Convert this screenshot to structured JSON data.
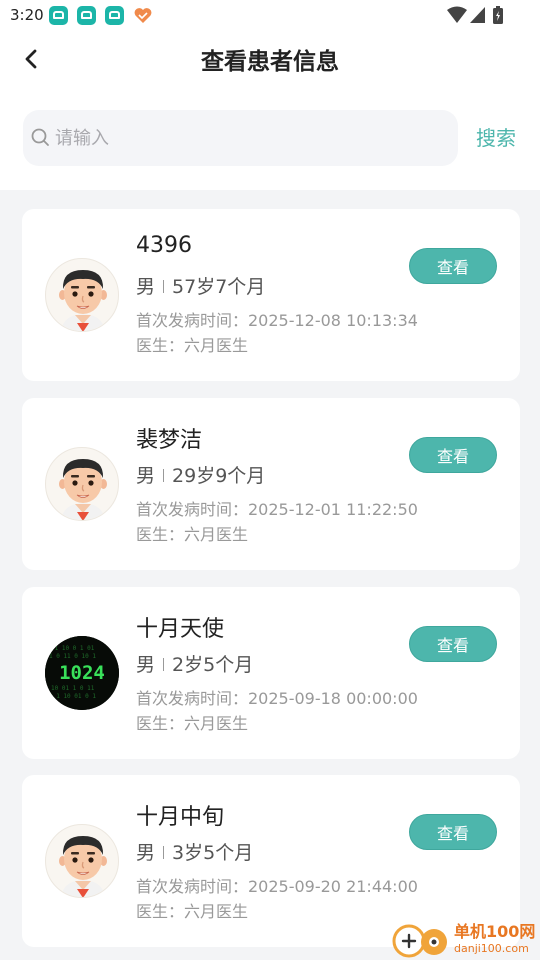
{
  "status_bar": {
    "time": "3:20",
    "notification_icons": [
      "car-app-icon",
      "car-app-icon",
      "car-app-icon",
      "heart-app-icon"
    ],
    "system_icons": [
      "wifi-icon",
      "cellular-signal-icon",
      "battery-icon"
    ]
  },
  "header": {
    "title": "查看患者信息",
    "back_icon": "back-arrow-icon"
  },
  "search": {
    "placeholder": "请输入",
    "value": "",
    "button_label": "搜索"
  },
  "patients": [
    {
      "name": "4396",
      "gender": "男",
      "age": "57岁7个月",
      "onset": "首次发病时间：2025-12-08 10:13:34",
      "doctor": "医生：六月医生",
      "view_label": "查看",
      "avatar": "cartoon-man"
    },
    {
      "name": "裴梦洁",
      "gender": "男",
      "age": "29岁9个月",
      "onset": "首次发病时间：2025-12-01 11:22:50",
      "doctor": "医生：六月医生",
      "view_label": "查看",
      "avatar": "cartoon-man"
    },
    {
      "name": "十月天使",
      "gender": "男",
      "age": "2岁5个月",
      "onset": "首次发病时间：2025-09-18 00:00:00",
      "doctor": "医生：六月医生",
      "view_label": "查看",
      "avatar": "code-1024",
      "avatar_text": "1024"
    },
    {
      "name": "十月中旬",
      "gender": "男",
      "age": "3岁5个月",
      "onset": "首次发病时间：2025-09-20 21:44:00",
      "doctor": "医生：六月医生",
      "view_label": "查看",
      "avatar": "cartoon-man"
    }
  ],
  "watermark": {
    "brand": "单机100网",
    "url": "danji100.com"
  },
  "colors": {
    "accent": "#4db6ac",
    "page_background": "#f3f4f6",
    "card_background": "#ffffff",
    "muted_text": "#999999"
  }
}
